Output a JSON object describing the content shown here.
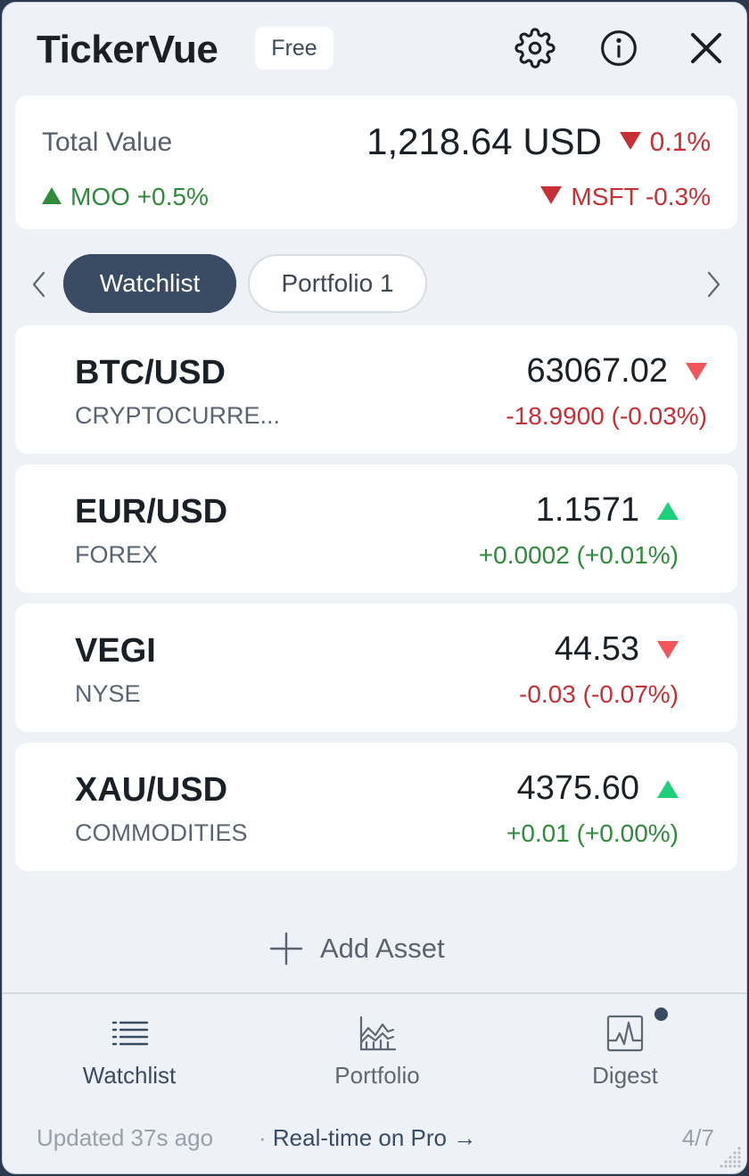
{
  "app": {
    "title": "TickerVue",
    "plan_badge": "Free"
  },
  "header_icons": [
    "gear-icon",
    "info-icon",
    "close-icon"
  ],
  "summary": {
    "label": "Total Value",
    "value": "1,218.64 USD",
    "change": "0.1%",
    "change_direction": "down",
    "top_mover_up": "MOO +0.5%",
    "top_mover_down": "MSFT -0.3%"
  },
  "tabs": [
    {
      "label": "Watchlist",
      "active": true
    },
    {
      "label": "Portfolio 1",
      "active": false
    }
  ],
  "assets": [
    {
      "symbol": "BTC/USD",
      "exchange": "CRYPTOCURRE...",
      "price": "63067.02",
      "change": "-18.9900 (-0.03%)",
      "direction": "down"
    },
    {
      "symbol": "EUR/USD",
      "exchange": "FOREX",
      "price": "1.1571",
      "change": "+0.0002 (+0.01%)",
      "direction": "up"
    },
    {
      "symbol": "VEGI",
      "exchange": "NYSE",
      "price": "44.53",
      "change": "-0.03 (-0.07%)",
      "direction": "down"
    },
    {
      "symbol": "XAU/USD",
      "exchange": "COMMODITIES",
      "price": "4375.60",
      "change": "+0.01 (+0.00%)",
      "direction": "up"
    }
  ],
  "add_asset_label": "Add Asset",
  "nav": [
    {
      "label": "Watchlist",
      "icon": "list-icon",
      "active": true
    },
    {
      "label": "Portfolio",
      "icon": "area-chart-icon",
      "active": false
    },
    {
      "label": "Digest",
      "icon": "pulse-chart-icon",
      "active": false,
      "has_notification": true
    }
  ],
  "footer": {
    "updated": "Updated 37s ago",
    "separator": "·",
    "promo": "Real-time on Pro →",
    "page": "4/7"
  },
  "colors": {
    "accent": "#3a4c64",
    "negative": "#c62f34",
    "positive": "#2f8a3c",
    "arrow_down": "#f0555a",
    "arrow_up": "#1fce7a"
  }
}
